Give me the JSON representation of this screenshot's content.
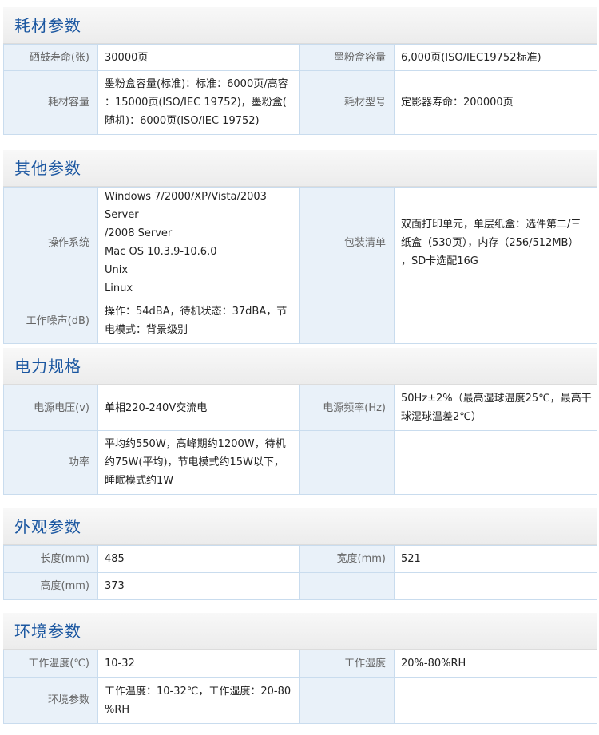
{
  "sections": [
    {
      "title": "耗材参数",
      "rows": [
        {
          "l1": "硒鼓寿命(张)",
          "v1": [
            "30000页"
          ],
          "l2": "墨粉盒容量",
          "v2": [
            "6,000页(ISO/IEC19752标准)"
          ]
        },
        {
          "l1": "耗材容量",
          "v1": [
            "墨粉盒容量(标准)：标准：6000页/高容",
            "：15000页(ISO/IEC 19752)，墨粉盒(",
            "随机)：6000页(ISO/IEC 19752)"
          ],
          "l2": "耗材型号",
          "v2": [
            "定影器寿命：200000页"
          ]
        }
      ]
    },
    {
      "title": "其他参数",
      "rows": [
        {
          "l1": "操作系统",
          "v1": [
            "Windows 7/2000/XP/Vista/2003 Server",
            "/2008 Server",
            "Mac OS 10.3.9-10.6.0",
            "Unix",
            "Linux"
          ],
          "l2": "包装清单",
          "v2": [
            "双面打印单元，单层纸盒：选件第二/三",
            "纸盒（530页），内存（256/512MB）",
            "，SD卡选配16G"
          ]
        },
        {
          "l1": "工作噪声(dB)",
          "v1": [
            "操作：54dBA，待机状态：37dBA，节",
            "电模式：背景级别"
          ],
          "l2": "",
          "v2": []
        }
      ]
    },
    {
      "title": "电力规格",
      "rows": [
        {
          "l1": "电源电压(v)",
          "v1": [
            "单相220-240V交流电"
          ],
          "l2": "电源频率(Hz)",
          "v2": [
            "50Hz±2%（最高湿球温度25℃，最高干",
            "球湿球温差2℃）"
          ]
        },
        {
          "l1": "功率",
          "v1": [
            "平均约550W，高峰期约1200W，待机",
            "约75W(平均)，节电模式约15W以下，",
            "睡眠模式约1W"
          ],
          "l2": "",
          "v2": []
        }
      ]
    },
    {
      "title": "外观参数",
      "rows": [
        {
          "l1": "长度(mm)",
          "v1": [
            "485"
          ],
          "l2": "宽度(mm)",
          "v2": [
            "521"
          ]
        },
        {
          "l1": "高度(mm)",
          "v1": [
            "373"
          ],
          "l2": "",
          "v2": []
        }
      ]
    },
    {
      "title": "环境参数",
      "rows": [
        {
          "l1": "工作温度(℃)",
          "v1": [
            "10-32"
          ],
          "l2": "工作湿度",
          "v2": [
            "20%-80%RH"
          ]
        },
        {
          "l1": "环境参数",
          "v1": [
            "工作温度：10-32℃，工作湿度：20-80",
            "%RH"
          ],
          "l2": "",
          "v2": []
        }
      ]
    }
  ]
}
